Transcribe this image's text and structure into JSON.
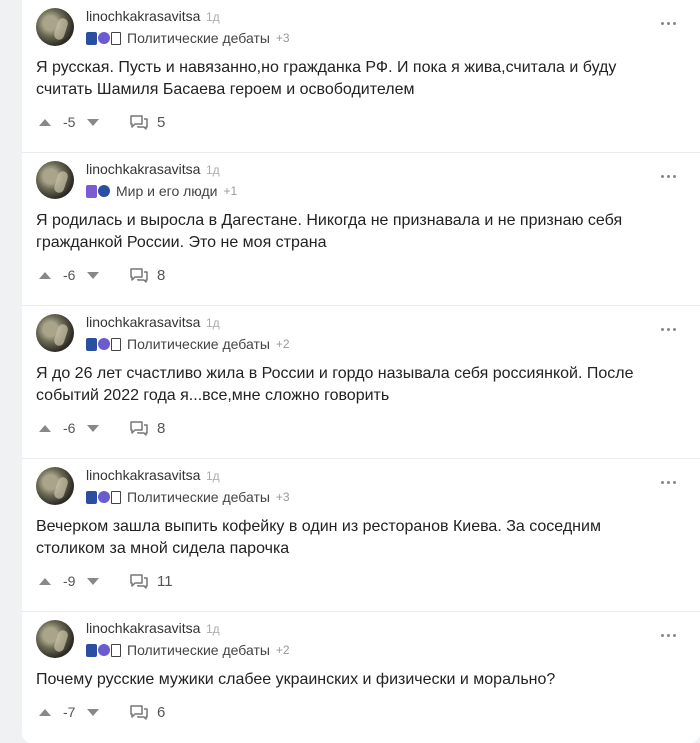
{
  "posts": [
    {
      "username": "linochkakrasavitsa",
      "time": "1д",
      "community": "Политические дебаты",
      "community_extra": "+3",
      "text": "Я русская. Пусть и навязанно,но гражданка РФ. И пока я жива,считала и буду считать Шамиля Басаева героем и освободителем",
      "score": "-5",
      "comments": "5"
    },
    {
      "username": "linochkakrasavitsa",
      "time": "1д",
      "community": "Мир и его люди",
      "community_extra": "+1",
      "text": "Я родилась и выросла в Дагестане. Никогда не признавала и не признаю себя гражданкой России. Это не моя страна",
      "score": "-6",
      "comments": "8"
    },
    {
      "username": "linochkakrasavitsa",
      "time": "1д",
      "community": "Политические дебаты",
      "community_extra": "+2",
      "text": "Я до 26 лет счастливо жила в России и гордо называла себя россиянкой. После событий 2022 года я...все,мне сложно говорить",
      "score": "-6",
      "comments": "8"
    },
    {
      "username": "linochkakrasavitsa",
      "time": "1д",
      "community": "Политические дебаты",
      "community_extra": "+3",
      "text": "Вечерком зашла выпить кофейку в один из ресторанов Киева. За соседним столиком за мной сидела парочка",
      "score": "-9",
      "comments": "11"
    },
    {
      "username": "linochkakrasavitsa",
      "time": "1д",
      "community": "Политические дебаты",
      "community_extra": "+2",
      "text": "Почему русские мужики слабее украинских и физически и морально?",
      "score": "-7",
      "comments": "6"
    }
  ],
  "icons": {
    "upvote": "arrow-up-icon",
    "downvote": "arrow-down-icon",
    "comments": "comment-bubble-icon",
    "more": "more-dots-icon"
  }
}
